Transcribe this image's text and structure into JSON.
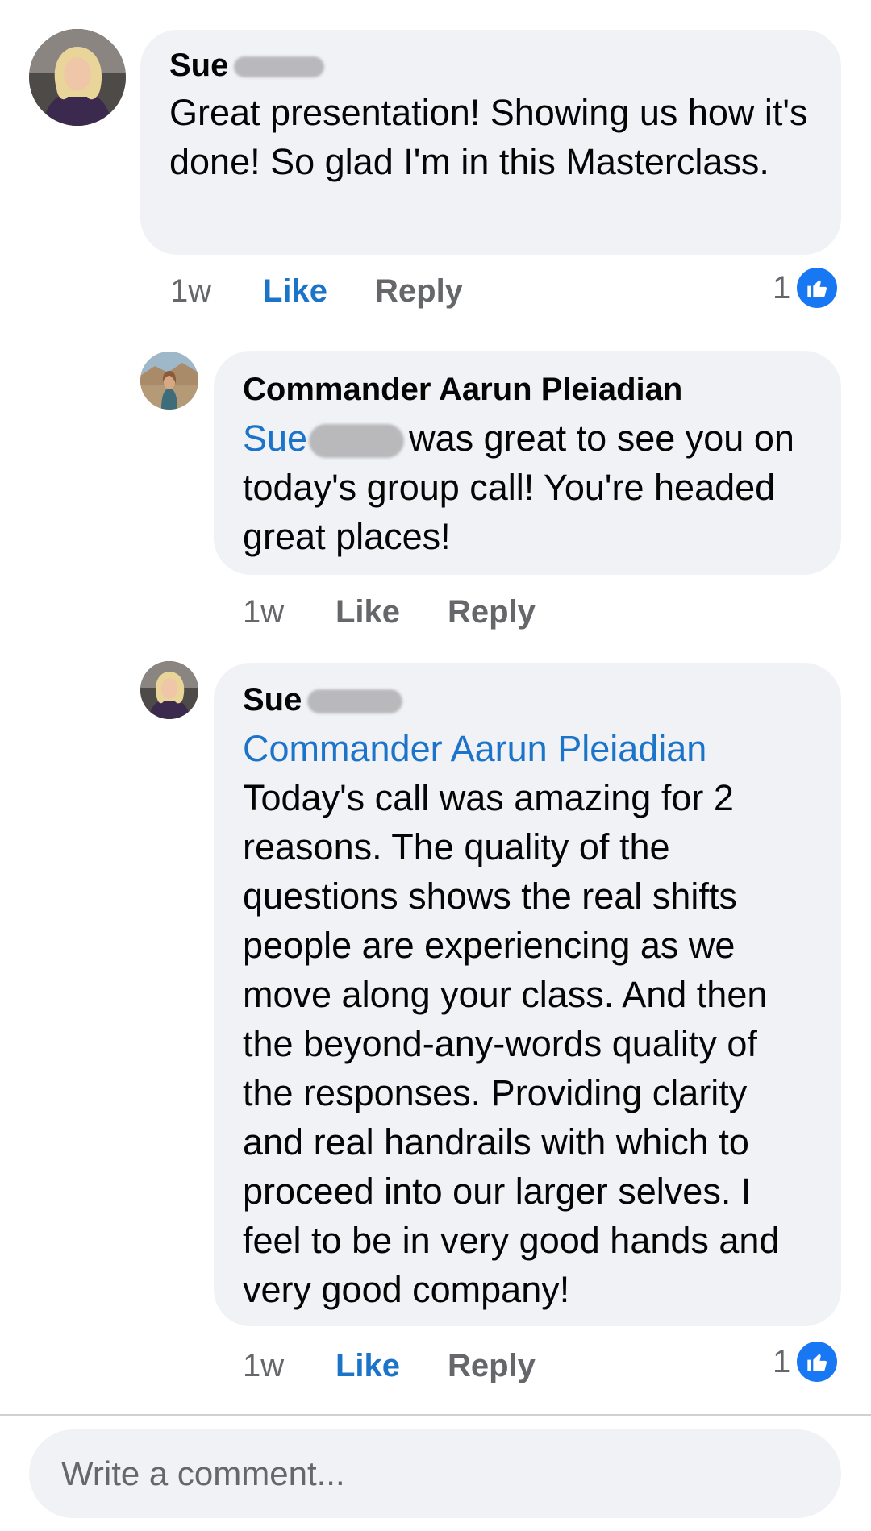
{
  "comments": [
    {
      "author": "Sue",
      "text": "Great presentation!  Showing us how it's done! So glad I'm in this Masterclass.",
      "time": "1w",
      "like_label": "Like",
      "reply_label": "Reply",
      "reaction_count": "1",
      "liked": true
    },
    {
      "author": "Commander Aarun Pleiadian",
      "mention": "Sue",
      "text": "was great to see you on today's group call! You're headed great places!",
      "time": "1w",
      "like_label": "Like",
      "reply_label": "Reply",
      "liked": false
    },
    {
      "author": "Sue",
      "mention": "Commander Aarun Pleiadian",
      "text": "Today's call was amazing for 2 reasons.  The quality of the questions shows the real shifts people are experiencing as we move along your class.  And then the beyond-any-words quality of the responses. Providing clarity and real handrails with which to proceed into our larger selves. I feel to be in very good hands and very good company!",
      "time": "1w",
      "like_label": "Like",
      "reply_label": "Reply",
      "reaction_count": "1",
      "liked": true
    }
  ],
  "composer": {
    "placeholder": "Write a comment..."
  },
  "icons": {
    "reaction": "like-thumbs-up-icon"
  },
  "colors": {
    "link": "#1b74c9",
    "bubble": "#f0f2f5",
    "like_badge": "#1877f2",
    "muted": "#65676b"
  }
}
